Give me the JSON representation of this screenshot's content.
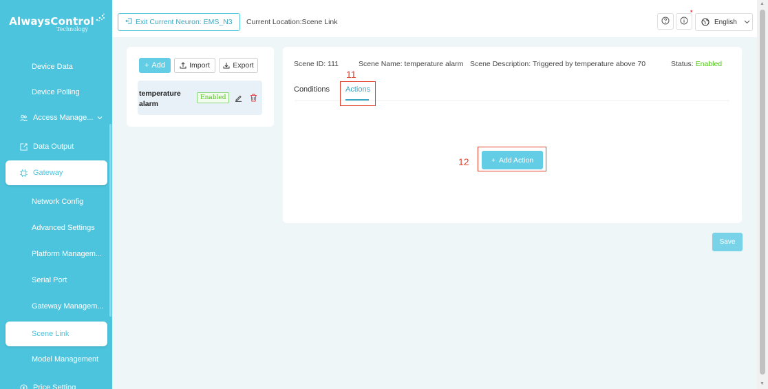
{
  "brand": {
    "name": "AlwaysControl",
    "tagline": "Technology"
  },
  "sidebar": {
    "items": [
      {
        "label": "Device Data"
      },
      {
        "label": "Device Polling"
      },
      {
        "label": "Access Manage...",
        "icon": "users-icon",
        "expandable": true
      },
      {
        "label": "Data Output",
        "icon": "export-icon"
      },
      {
        "label": "Gateway",
        "icon": "gateway-icon",
        "highlighted": true
      },
      {
        "label": "Network Config"
      },
      {
        "label": "Advanced Settings"
      },
      {
        "label": "Platform Managem..."
      },
      {
        "label": "Serial Port"
      },
      {
        "label": "Gateway Managem..."
      },
      {
        "label": "Scene Link",
        "active": true
      },
      {
        "label": "Model Management"
      },
      {
        "label": "Price Setting",
        "icon": "price-icon"
      }
    ]
  },
  "header": {
    "exit_label": "Exit Current Neuron: EMS_N3",
    "location": "Current Location:Scene Link",
    "language": "English",
    "icons": [
      "help-icon",
      "info-icon",
      "globe-icon"
    ]
  },
  "scene_list": {
    "add_label": "Add",
    "import_label": "Import",
    "export_label": "Export",
    "items": [
      {
        "name": "temperature alarm",
        "status": "Enabled"
      }
    ]
  },
  "scene_detail": {
    "id_text": "Scene ID: 111",
    "name_text": "Scene Name: temperature alarm",
    "description_text": "Scene Description: Triggered by temperature above 70",
    "status_label": "Status:",
    "status_value": "Enabled",
    "tabs": [
      {
        "label": "Conditions",
        "active": false
      },
      {
        "label": "Actions",
        "active": true
      }
    ],
    "add_action_label": "Add Action"
  },
  "annotations": [
    {
      "number": "11",
      "target": "actions-tab"
    },
    {
      "number": "12",
      "target": "add-action-button"
    }
  ],
  "save_label": "Save",
  "colors": {
    "accent": "#4cc4dd",
    "status_enabled": "#52c41a",
    "annotation": "#e3402c"
  }
}
